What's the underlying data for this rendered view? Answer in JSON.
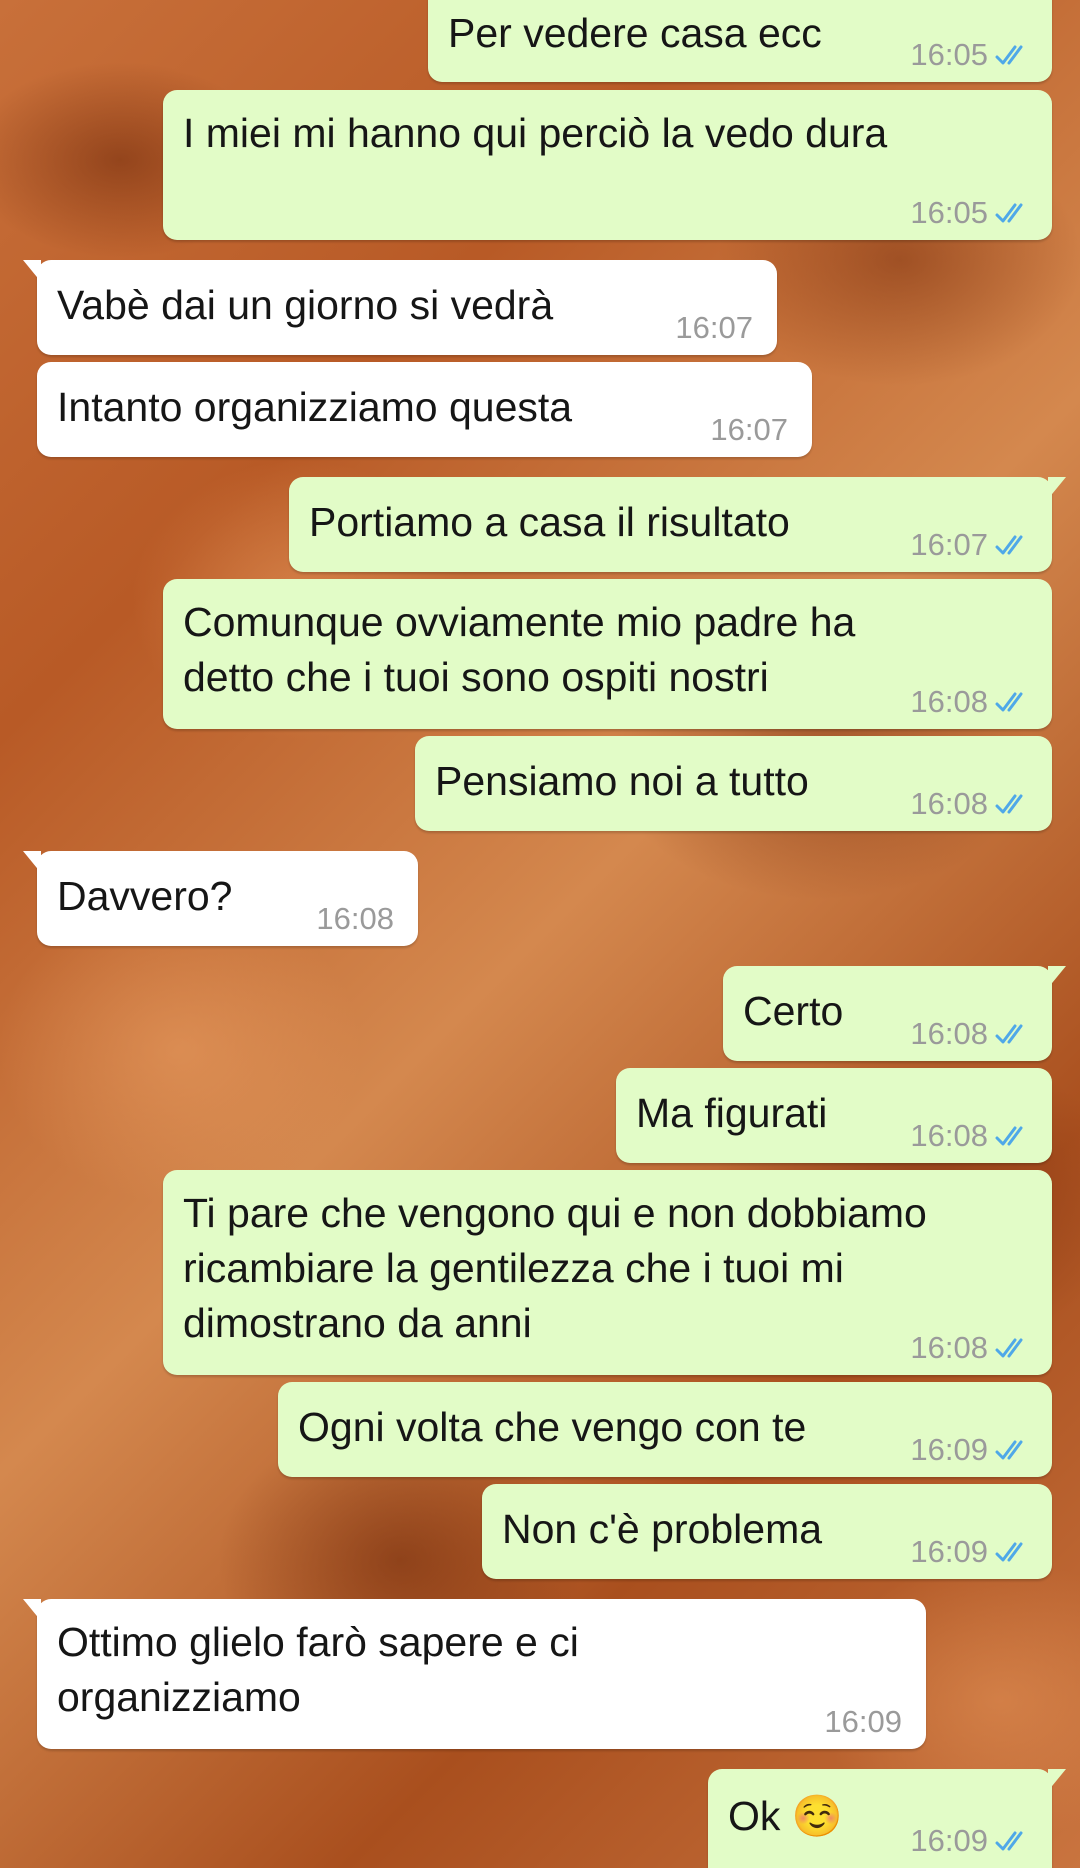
{
  "colors": {
    "outgoing_bubble": "#e2fcc7",
    "incoming_bubble": "#ffffff",
    "read_ticks": "#4fa8e8",
    "timestamp": "#9a9a9a"
  },
  "tick_icon": "double-check-icon",
  "messages": [
    {
      "direction": "out",
      "text": "Per vedere casa ecc",
      "time": "16:05",
      "status": "read"
    },
    {
      "direction": "out",
      "text": "I miei mi hanno qui perciò la vedo dura",
      "time": "16:05",
      "status": "read"
    },
    {
      "direction": "in",
      "text": "Vabè dai un giorno si vedrà",
      "time": "16:07"
    },
    {
      "direction": "in",
      "text": "Intanto organizziamo questa",
      "time": "16:07"
    },
    {
      "direction": "out",
      "text": "Portiamo a casa il risultato",
      "time": "16:07",
      "status": "read"
    },
    {
      "direction": "out",
      "text": "Comunque ovviamente mio padre ha\ndetto che i tuoi sono ospiti nostri",
      "time": "16:08",
      "status": "read"
    },
    {
      "direction": "out",
      "text": "Pensiamo noi a tutto",
      "time": "16:08",
      "status": "read"
    },
    {
      "direction": "in",
      "text": "Davvero?",
      "time": "16:08"
    },
    {
      "direction": "out",
      "text": "Certo",
      "time": "16:08",
      "status": "read"
    },
    {
      "direction": "out",
      "text": "Ma figurati",
      "time": "16:08",
      "status": "read"
    },
    {
      "direction": "out",
      "text": "Ti pare che vengono qui e non dobbiamo\nricambiare la gentilezza che i tuoi mi\ndimostrano da anni",
      "time": "16:08",
      "status": "read"
    },
    {
      "direction": "out",
      "text": "Ogni volta che vengo con te",
      "time": "16:09",
      "status": "read"
    },
    {
      "direction": "out",
      "text": "Non c'è problema",
      "time": "16:09",
      "status": "read"
    },
    {
      "direction": "in",
      "text": "Ottimo glielo farò sapere e ci\norganizziamo",
      "time": "16:09"
    },
    {
      "direction": "out",
      "text": "Ok ☺️",
      "time": "16:09",
      "status": "read"
    }
  ]
}
